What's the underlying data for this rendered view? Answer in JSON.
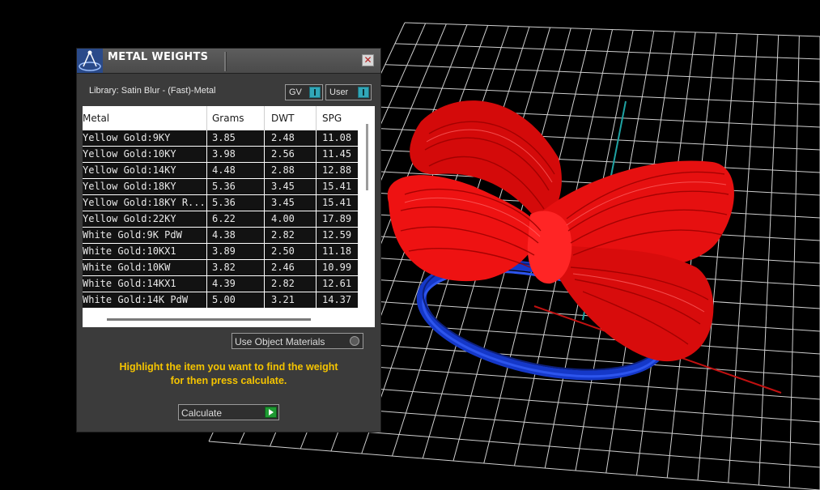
{
  "panel": {
    "title": "METAL WEIGHTS",
    "close_icon": "close-icon",
    "library_label": "Library: Satin Blur - (Fast)-Metal",
    "toggles": {
      "gv": "GV",
      "user": "User"
    },
    "accent_color": "#31a7b8"
  },
  "table": {
    "columns": [
      "Metal",
      "Grams",
      "DWT",
      "SPG"
    ],
    "rows": [
      [
        "Yellow Gold:9KY",
        "3.85",
        "2.48",
        "11.08"
      ],
      [
        "Yellow Gold:10KY",
        "3.98",
        "2.56",
        "11.45"
      ],
      [
        "Yellow Gold:14KY",
        "4.48",
        "2.88",
        "12.88"
      ],
      [
        "Yellow Gold:18KY",
        "5.36",
        "3.45",
        "15.41"
      ],
      [
        "Yellow Gold:18KY R...",
        "5.36",
        "3.45",
        "15.41"
      ],
      [
        "Yellow Gold:22KY",
        "6.22",
        "4.00",
        "17.89"
      ],
      [
        "White Gold:9K PdW",
        "4.38",
        "2.82",
        "12.59"
      ],
      [
        "White Gold:10KX1",
        "3.89",
        "2.50",
        "11.18"
      ],
      [
        "White Gold:10KW",
        "3.82",
        "2.46",
        "10.99"
      ],
      [
        "White Gold:14KX1",
        "4.39",
        "2.82",
        "12.61"
      ],
      [
        "White Gold:14K PdW",
        "5.00",
        "3.21",
        "14.37"
      ]
    ]
  },
  "controls": {
    "use_object_materials": "Use Object Materials",
    "instruction_line1": "Highlight the item you want to find the weight",
    "instruction_line2": "for then press calculate.",
    "calculate": "Calculate",
    "instruction_color": "#f5c400"
  },
  "viewport": {
    "model_colors": {
      "bow": "#ff1a1a",
      "band": "#1538c8",
      "grid": "#cfcfcf"
    }
  }
}
